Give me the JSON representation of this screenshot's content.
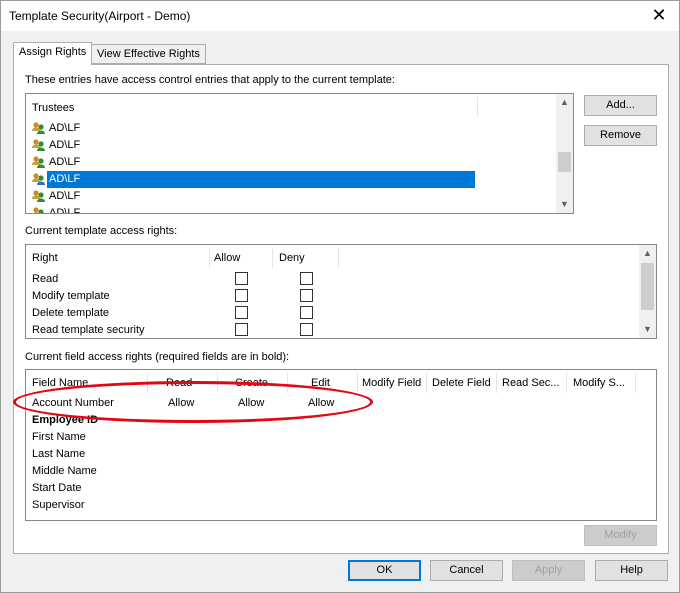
{
  "window": {
    "title": "Template Security(Airport - Demo)"
  },
  "tabs": [
    {
      "label": "Assign Rights",
      "active": true
    },
    {
      "label": "View Effective Rights",
      "active": false
    }
  ],
  "trustees": {
    "caption": "These entries have access control entries that apply to the current template:",
    "header": "Trustees",
    "items": [
      "AD\\LF",
      "AD\\LF",
      "AD\\LF",
      "AD\\LF",
      "AD\\LF",
      "AD\\LF"
    ],
    "selected_index": 3,
    "add_label": "Add...",
    "remove_label": "Remove"
  },
  "template_rights": {
    "caption": "Current template access rights:",
    "headers": [
      "Right",
      "Allow",
      "Deny"
    ],
    "rows": [
      {
        "right": "Read",
        "allow": false,
        "deny": false
      },
      {
        "right": "Modify template",
        "allow": false,
        "deny": false
      },
      {
        "right": "Delete template",
        "allow": false,
        "deny": false
      },
      {
        "right": "Read template security",
        "allow": false,
        "deny": false
      }
    ]
  },
  "field_rights": {
    "caption": "Current field access rights (required fields are in bold):",
    "headers": [
      "Field Name",
      "Read",
      "Create",
      "Edit",
      "Modify Field",
      "Delete Field",
      "Read Sec...",
      "Modify S..."
    ],
    "rows": [
      {
        "name": "Account Number",
        "read": "Allow",
        "create": "Allow",
        "edit": "Allow",
        "bold": false
      },
      {
        "name": "Employee ID",
        "read": "",
        "create": "",
        "edit": "",
        "bold": true
      },
      {
        "name": "First Name",
        "read": "",
        "create": "",
        "edit": "",
        "bold": false
      },
      {
        "name": "Last Name",
        "read": "",
        "create": "",
        "edit": "",
        "bold": false
      },
      {
        "name": "Middle Name",
        "read": "",
        "create": "",
        "edit": "",
        "bold": false
      },
      {
        "name": "Start Date",
        "read": "",
        "create": "",
        "edit": "",
        "bold": false
      },
      {
        "name": "Supervisor",
        "read": "",
        "create": "",
        "edit": "",
        "bold": false
      }
    ],
    "modify_label": "Modify"
  },
  "footer": {
    "ok": "OK",
    "cancel": "Cancel",
    "apply": "Apply",
    "help": "Help"
  },
  "colors": {
    "selection": "#0078d7",
    "annotation": "#e30613",
    "default_button": "#0078d7"
  },
  "icons": {
    "close": "close-icon",
    "trustee": "group-user-icon"
  }
}
